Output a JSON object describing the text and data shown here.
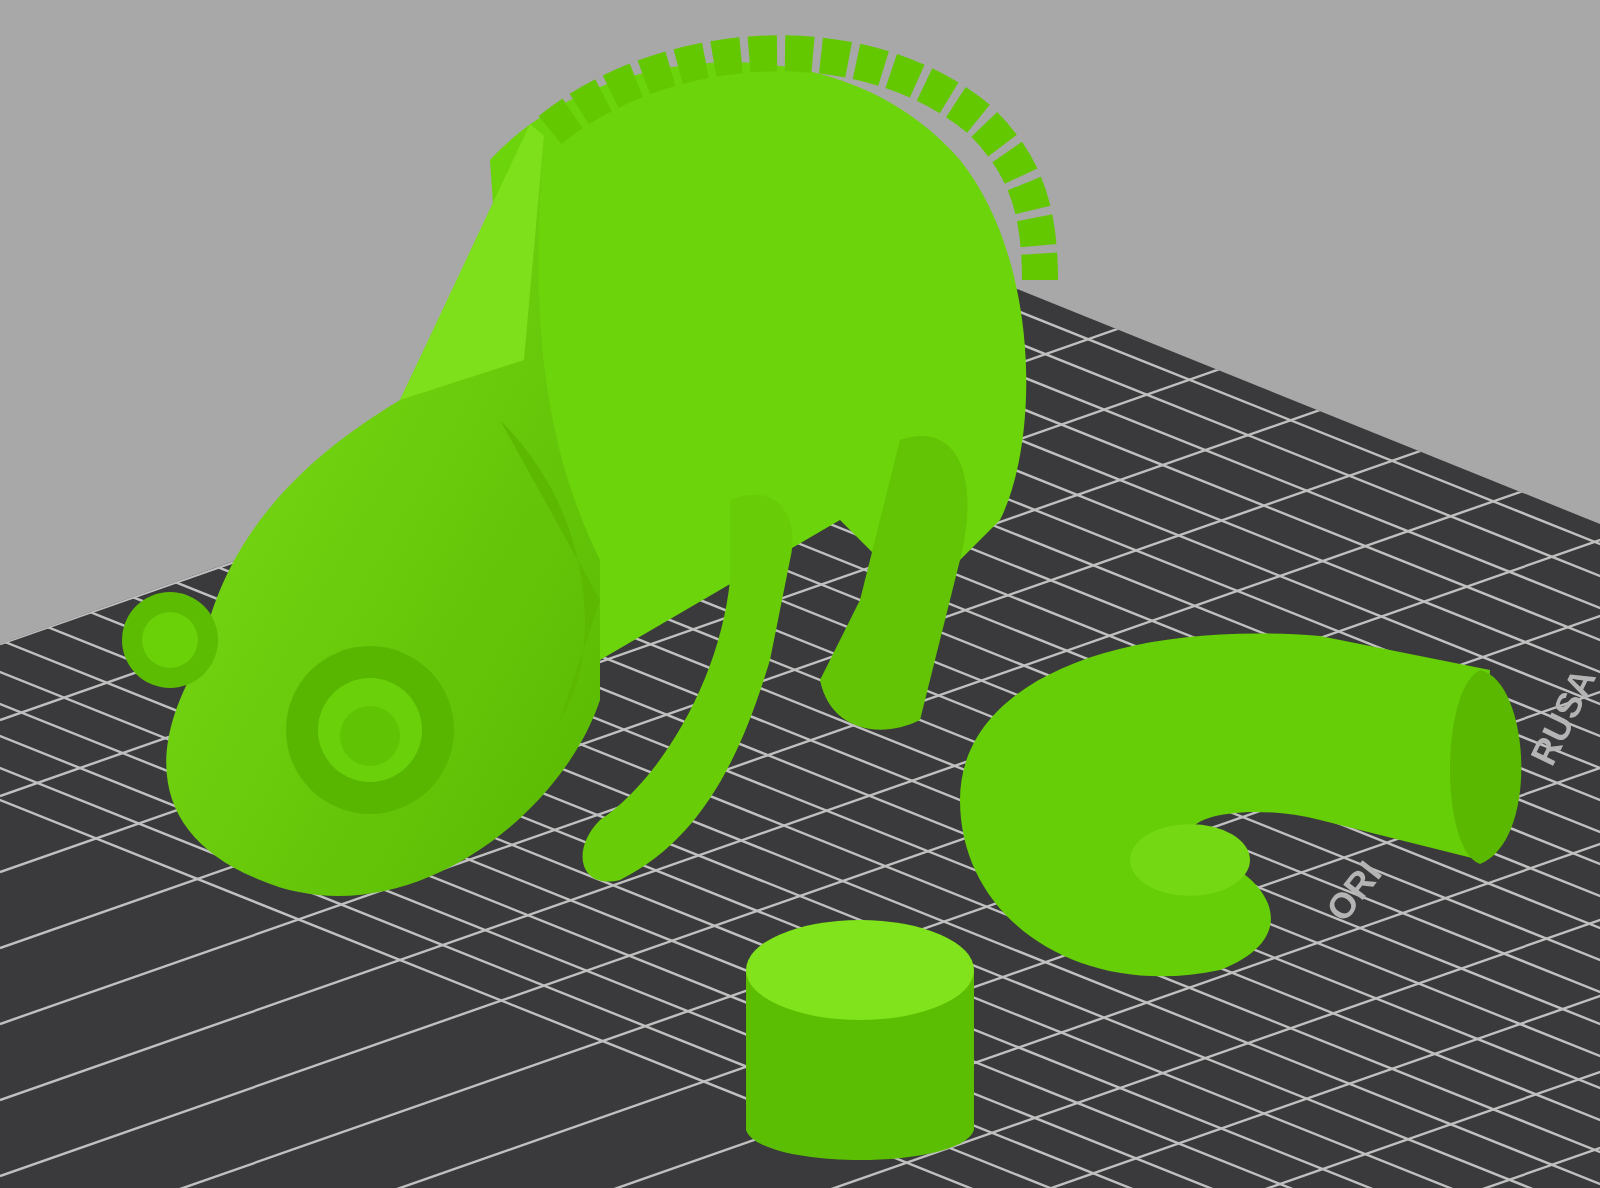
{
  "scene": {
    "bed_labels": [
      {
        "text": "ORI"
      },
      {
        "text": "RUSA"
      }
    ]
  }
}
